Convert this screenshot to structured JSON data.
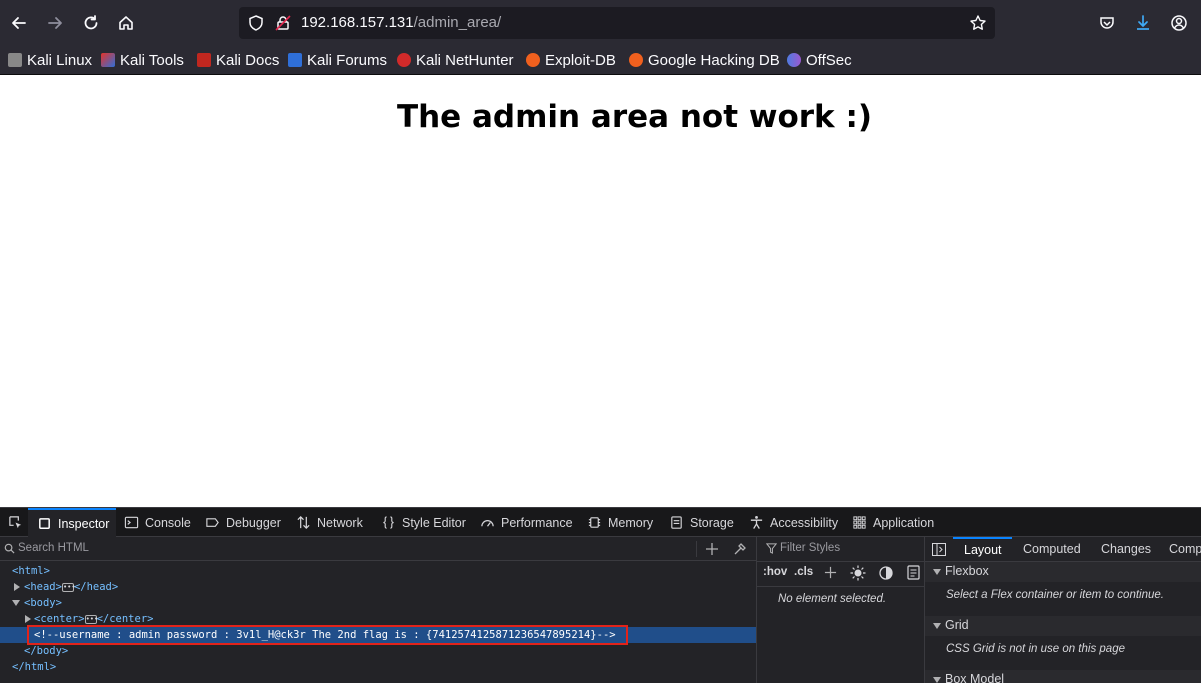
{
  "toolbar": {
    "url_host": "192.168.157.131",
    "url_path": "/admin_area/"
  },
  "bookmarks": [
    {
      "label": "Kali Linux",
      "color": "#cccccc"
    },
    {
      "label": "Kali Tools",
      "color": "#e5332a"
    },
    {
      "label": "Kali Docs",
      "color": "#e5332a"
    },
    {
      "label": "Kali Forums",
      "color": "#2f6fd8"
    },
    {
      "label": "Kali NetHunter",
      "color": "#e5332a"
    },
    {
      "label": "Exploit-DB",
      "color": "#f0601e"
    },
    {
      "label": "Google Hacking DB",
      "color": "#f0601e"
    },
    {
      "label": "OffSec",
      "color": "#4f7be0"
    }
  ],
  "page": {
    "heading": "The admin area not work :)"
  },
  "devtools": {
    "tabs": [
      "Inspector",
      "Console",
      "Debugger",
      "Network",
      "Style Editor",
      "Performance",
      "Memory",
      "Storage",
      "Accessibility",
      "Application"
    ],
    "search_placeholder": "Search HTML",
    "tree": {
      "html_open": "<html>",
      "head_open": "<head>",
      "head_close": "</head>",
      "body_open": "<body>",
      "center_open": "<center>",
      "center_close": "</center>",
      "comment": "<!--username : admin password : 3v1l_H@ck3r The 2nd flag is : {7412574125871236547895214}-->",
      "body_close": "</body>",
      "html_close": "</html>"
    },
    "styles": {
      "filter_placeholder": "Filter Styles",
      "hov": ":hov",
      "cls": ".cls",
      "empty": "No element selected."
    },
    "layout": {
      "tabs": [
        "Layout",
        "Computed",
        "Changes",
        "Comp"
      ],
      "flexbox_title": "Flexbox",
      "flexbox_msg": "Select a Flex container or item to continue.",
      "grid_title": "Grid",
      "grid_msg": "CSS Grid is not in use on this page",
      "boxmodel_title": "Box Model"
    }
  }
}
